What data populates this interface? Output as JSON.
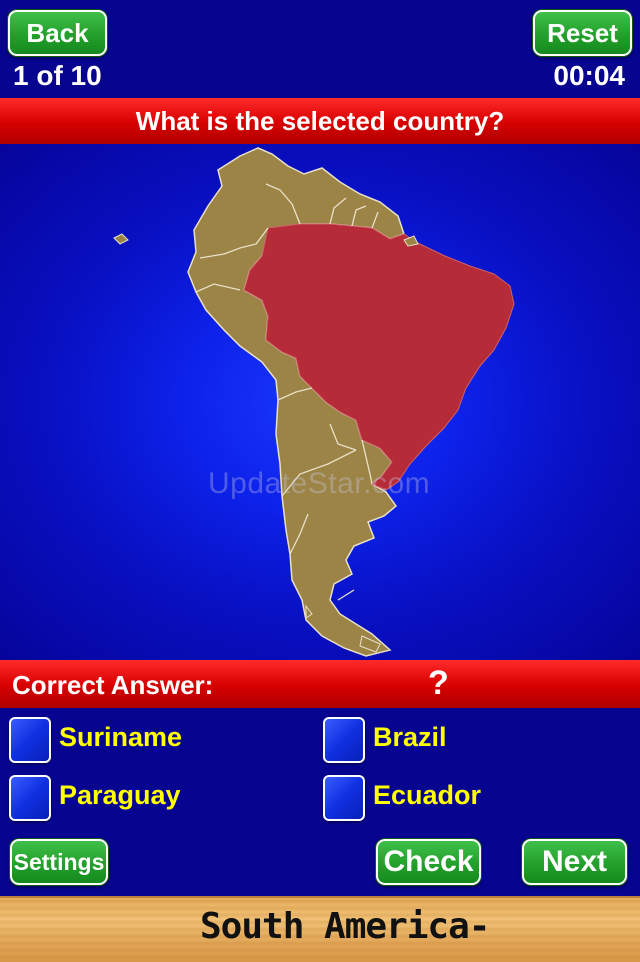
{
  "header": {
    "back_label": "Back",
    "reset_label": "Reset",
    "progress": "1 of 10",
    "timer": "00:04"
  },
  "question": "What is the selected country?",
  "map": {
    "region": "South America",
    "selected_country": "Brazil",
    "selected_color": "#b52c38",
    "land_color": "#9c8446",
    "border_color": "#e8e0c8",
    "ocean_color": "#0d22ea",
    "watermark": "UpdateStar.com"
  },
  "answer": {
    "label": "Correct Answer:",
    "value": "?"
  },
  "options": [
    {
      "label": "Suriname"
    },
    {
      "label": "Brazil"
    },
    {
      "label": "Paraguay"
    },
    {
      "label": "Ecuador"
    }
  ],
  "footer": {
    "settings_label": "Settings",
    "check_label": "Check",
    "next_label": "Next",
    "region_label": "South America-"
  }
}
